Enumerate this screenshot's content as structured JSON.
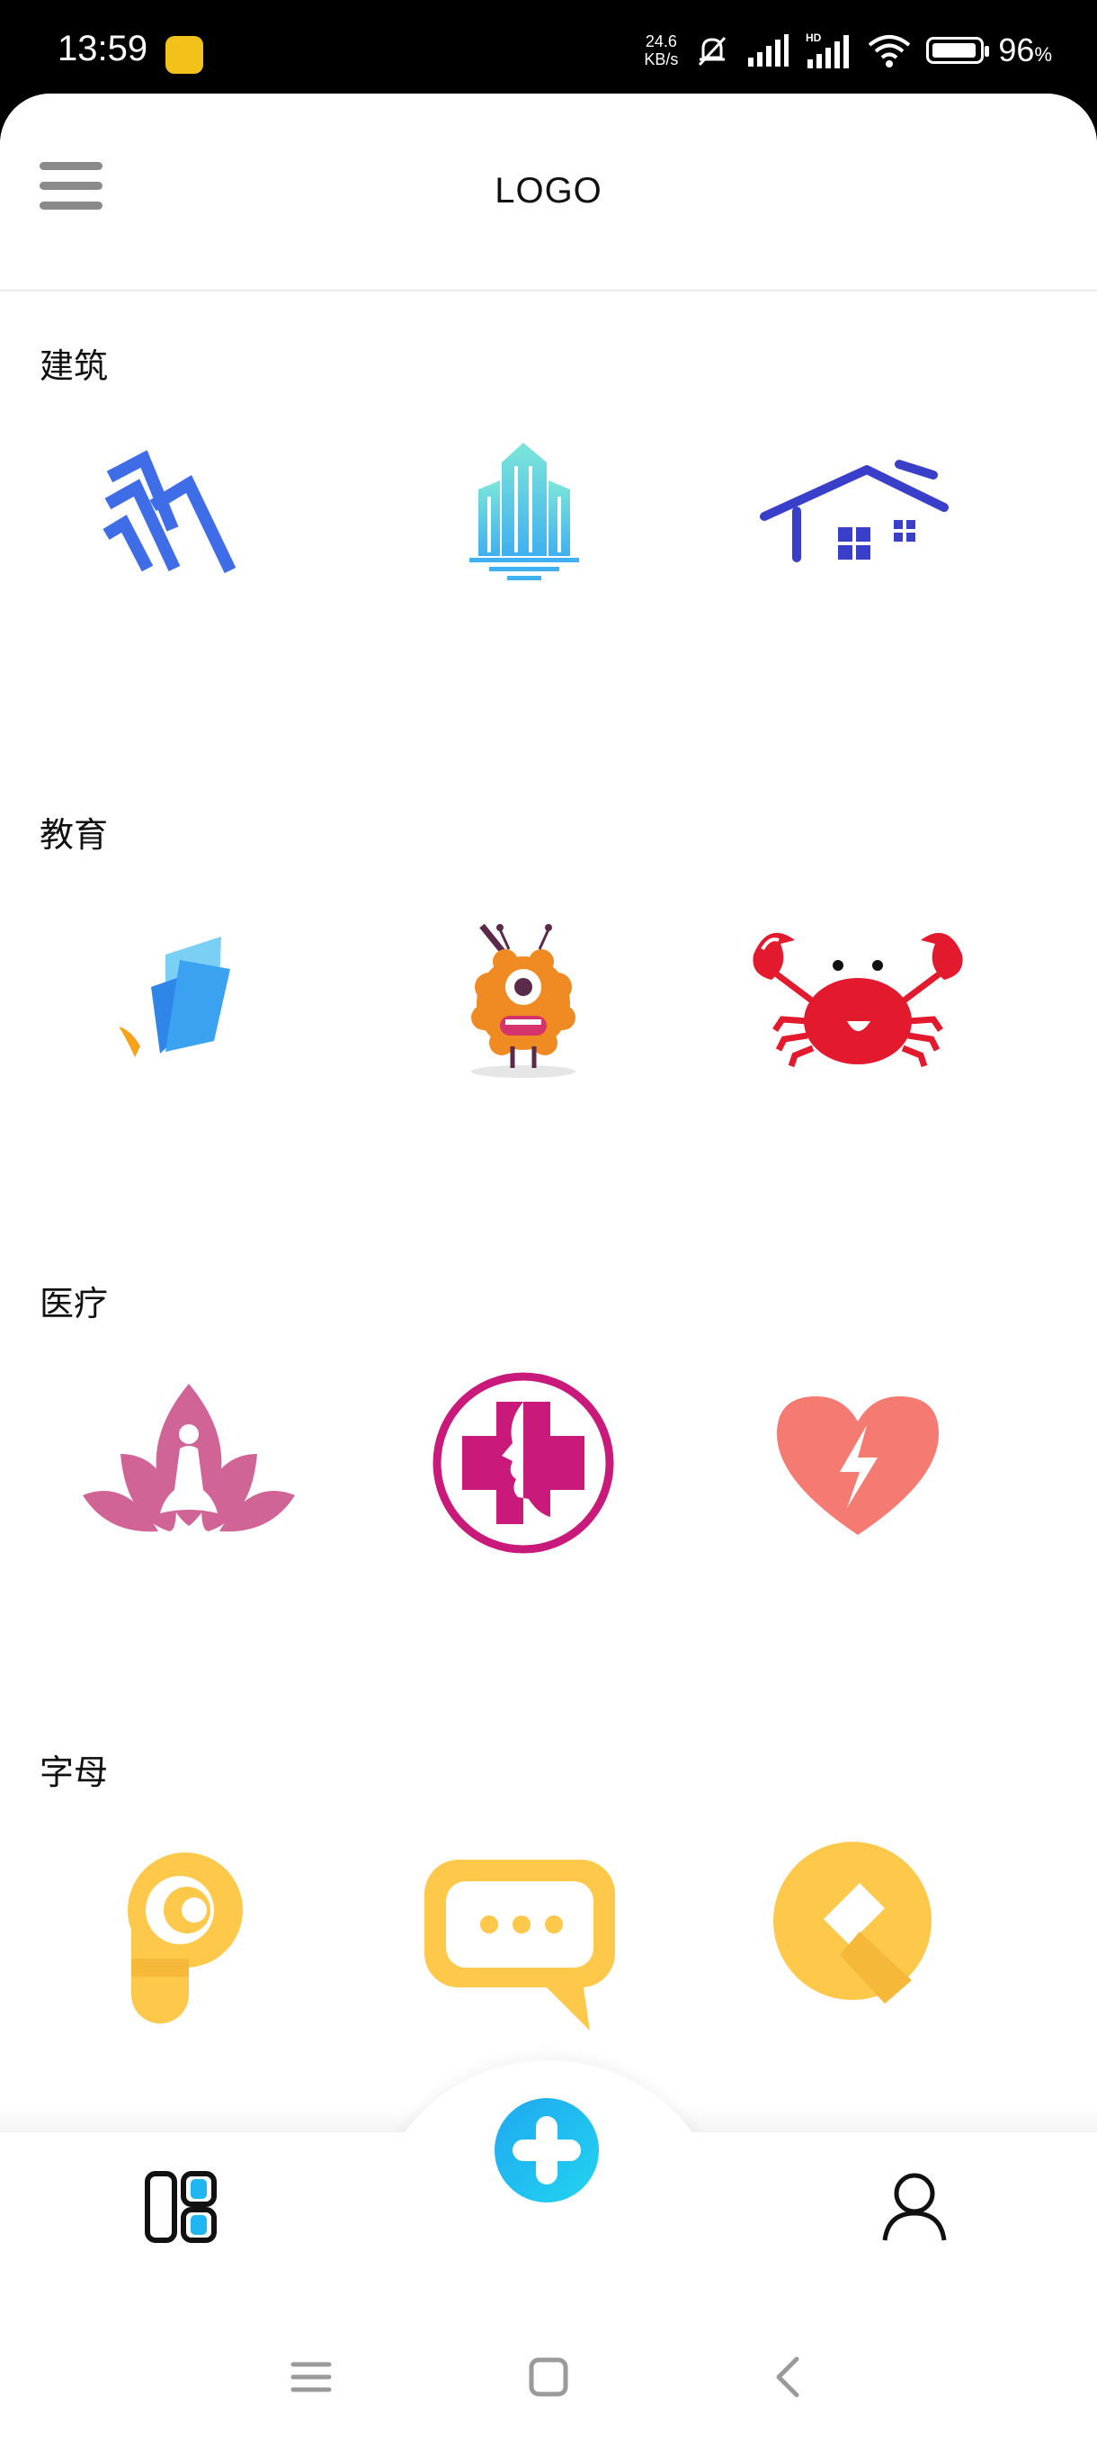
{
  "status_bar": {
    "time": "13:59",
    "speed_value": "24.6",
    "speed_unit": "KB/s",
    "battery_pct": "96",
    "battery_suffix": "%"
  },
  "header": {
    "title": "LOGO"
  },
  "sections": [
    {
      "title": "建筑",
      "logos": [
        "building-mountain-logo",
        "skyscraper-logo",
        "house-logo"
      ]
    },
    {
      "title": "教育",
      "logos": [
        "book-logo",
        "monster-mascot-logo",
        "crab-logo"
      ]
    },
    {
      "title": "医疗",
      "logos": [
        "lotus-meditation-logo",
        "medical-cross-face-logo",
        "heart-lightning-logo"
      ]
    },
    {
      "title": "字母",
      "logos": [
        "letter-p-logo",
        "chat-bubble-logo",
        "letter-q-logo"
      ]
    }
  ],
  "colors": {
    "accent_blue": "#1fb6f2",
    "build_blue": "#3f6de8",
    "house_blue": "#3a3fc9",
    "edu_orange": "#f08a22",
    "crab_red": "#e3192d",
    "medical_pink": "#c9197a",
    "heart_coral": "#f47a72",
    "letter_yellow": "#fec94a"
  },
  "icons": {
    "tab_left": "templates-grid-icon",
    "tab_center": "add-plus-icon",
    "tab_right": "user-profile-icon",
    "nav": [
      "menu-lines-icon",
      "home-square-icon",
      "back-chevron-icon"
    ]
  }
}
